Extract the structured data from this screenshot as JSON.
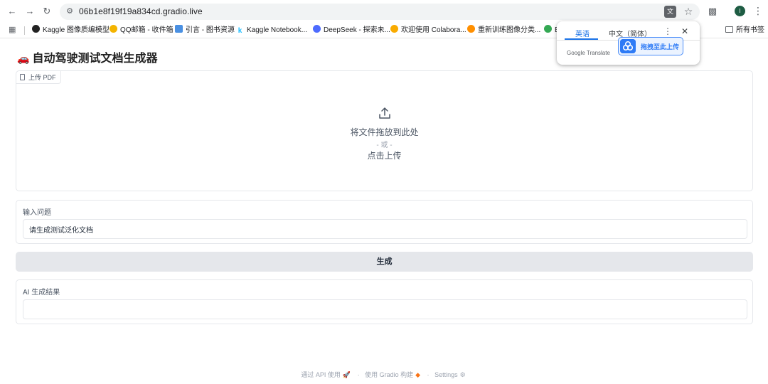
{
  "browser": {
    "url": "06b1e8f19f19a834cd.gradio.live",
    "profile_initial": "I",
    "bookmarks": [
      {
        "label": "Kaggle 图像质编模型"
      },
      {
        "label": "QQ邮箱 - 收件箱"
      },
      {
        "label": "引言 - 图书资源"
      },
      {
        "label": "Kaggle Notebook..."
      },
      {
        "label": "DeepSeek - 探索未..."
      },
      {
        "label": "欢迎使用 Colabora..."
      },
      {
        "label": "重新训练图像分类..."
      },
      {
        "label": "B"
      }
    ],
    "all_bookmarks": "所有书签"
  },
  "translate_popup": {
    "tab_source": "英语",
    "tab_target": "中文（简体）",
    "brand": "Google Translate"
  },
  "baidu_upload": {
    "label": "拖拽至此上传"
  },
  "app": {
    "title_emoji": "🚗",
    "title": "自动驾驶测试文档生成器",
    "upload": {
      "label": "上传 PDF",
      "drop_text": "将文件拖放到此处",
      "or_text": "- 或 -",
      "click_text": "点击上传"
    },
    "question": {
      "label": "输入问题",
      "value": "请生成测试泛化文档"
    },
    "generate_label": "生成",
    "output": {
      "label": "AI 生成结果",
      "value": ""
    },
    "footer": {
      "api": "通过 API 使用",
      "built": "使用 Gradio 构建",
      "settings": "Settings"
    }
  },
  "colors": {
    "accent": "#1a73e8",
    "button_bg": "#e5e7eb",
    "border": "#e5e7eb",
    "baidu_blue": "#2e7bf6"
  }
}
